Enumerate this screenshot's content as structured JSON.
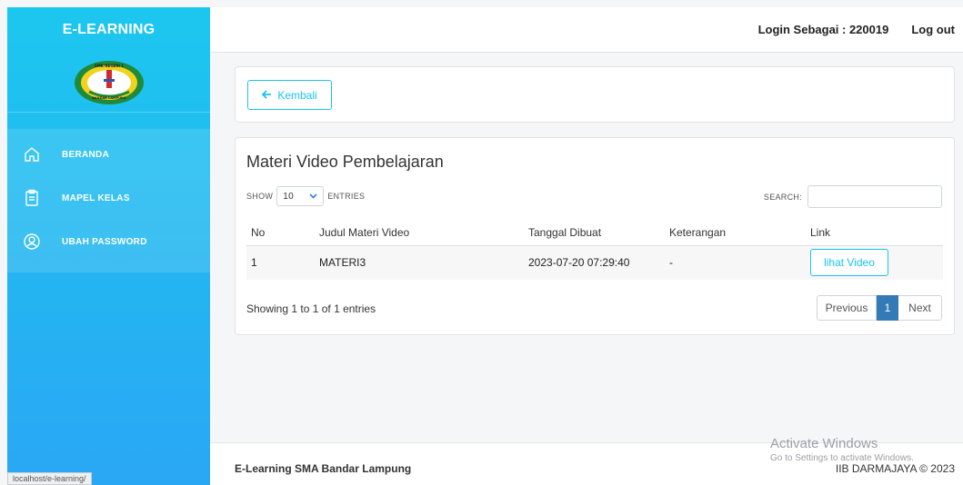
{
  "sidebar": {
    "brand": "E-LEARNING",
    "logo_text": "SMK NEGERI 1 BANDAR LAMPUNG",
    "items": [
      {
        "label": "BERANDA",
        "icon": "home-icon"
      },
      {
        "label": "MAPEL KELAS",
        "icon": "clipboard-icon"
      },
      {
        "label": "UBAH PASSWORD",
        "icon": "user-circle-icon"
      }
    ],
    "status_url": "localhost/e-learning/"
  },
  "topbar": {
    "login_text": "Login Sebagai : 220019",
    "logout_label": "Log out"
  },
  "back_button": {
    "label": "Kembali",
    "icon": "arrow-left-icon"
  },
  "main": {
    "title": "Materi Video Pembelajaran",
    "show_label": "SHOW",
    "entries_label": "ENTRIES",
    "page_size": "10",
    "search_label": "SEARCH:",
    "search_value": "",
    "columns": [
      "No",
      "Judul Materi Video",
      "Tanggal Dibuat",
      "Keterangan",
      "Link"
    ],
    "rows": [
      {
        "no": "1",
        "judul": "MATERI3",
        "tanggal": "2023-07-20 07:29:40",
        "keterangan": "-",
        "link_label": "lihat Video"
      }
    ],
    "showing_text": "Showing 1 to 1 of 1 entries",
    "pager": {
      "prev": "Previous",
      "current": "1",
      "next": "Next"
    }
  },
  "footer": {
    "left": "E-Learning SMA Bandar Lampung",
    "right": "IIB DARMAJAYA © 2023"
  },
  "watermark": {
    "line1": "Activate Windows",
    "line2": "Go to Settings to activate Windows."
  },
  "colors": {
    "accent": "#1ac3ef",
    "sidebar_top": "#1cc7ef",
    "sidebar_bottom": "#2aa7f4",
    "pager_active": "#337ab7"
  }
}
